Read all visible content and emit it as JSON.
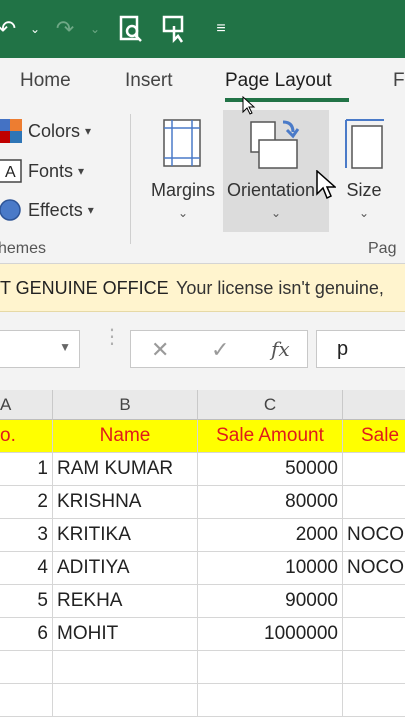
{
  "colors": {
    "accent": "#217346",
    "header_fill": "#ffff00",
    "header_text": "#e01b1b",
    "license_bar": "#fff4ce"
  },
  "quick_access": [
    "undo-icon",
    "redo-icon",
    "print-preview-icon",
    "touch-mode-icon",
    "customize-icon"
  ],
  "tabs": [
    {
      "label": "Home",
      "active": false
    },
    {
      "label": "Insert",
      "active": false
    },
    {
      "label": "Page Layout",
      "active": true
    },
    {
      "label": "F",
      "active": false
    }
  ],
  "ribbon": {
    "themes": {
      "items": [
        {
          "label": "Colors",
          "icon": "theme-colors-icon"
        },
        {
          "label": "Fonts",
          "icon": "theme-fonts-icon"
        },
        {
          "label": "Effects",
          "icon": "theme-effects-icon"
        }
      ],
      "group_label": "hemes"
    },
    "page_setup": {
      "buttons": [
        {
          "label": "Margins",
          "icon": "margins-icon"
        },
        {
          "label": "Orientation",
          "icon": "orientation-icon"
        },
        {
          "label": "Size",
          "icon": "size-icon"
        }
      ],
      "group_label": "Pag"
    }
  },
  "license_bar": {
    "title": "T GENUINE OFFICE",
    "message": "Your license isn't genuine,"
  },
  "formula_bar": {
    "name_box": "",
    "cancel": "✕",
    "enter": "✓",
    "fx": "fx",
    "content": "p"
  },
  "sheet": {
    "column_headers": [
      "A",
      "B",
      "C",
      ""
    ],
    "header_row": [
      "o.",
      "Name",
      "Sale Amount",
      "Sale"
    ],
    "rows": [
      [
        "1",
        "RAM KUMAR",
        "50000",
        ""
      ],
      [
        "2",
        "KRISHNA",
        "80000",
        ""
      ],
      [
        "3",
        "KRITIKA",
        "2000",
        "NOCO"
      ],
      [
        "4",
        "ADITIYA",
        "10000",
        "NOCO"
      ],
      [
        "5",
        "REKHA",
        "90000",
        ""
      ],
      [
        "6",
        "MOHIT",
        "1000000",
        ""
      ]
    ]
  }
}
